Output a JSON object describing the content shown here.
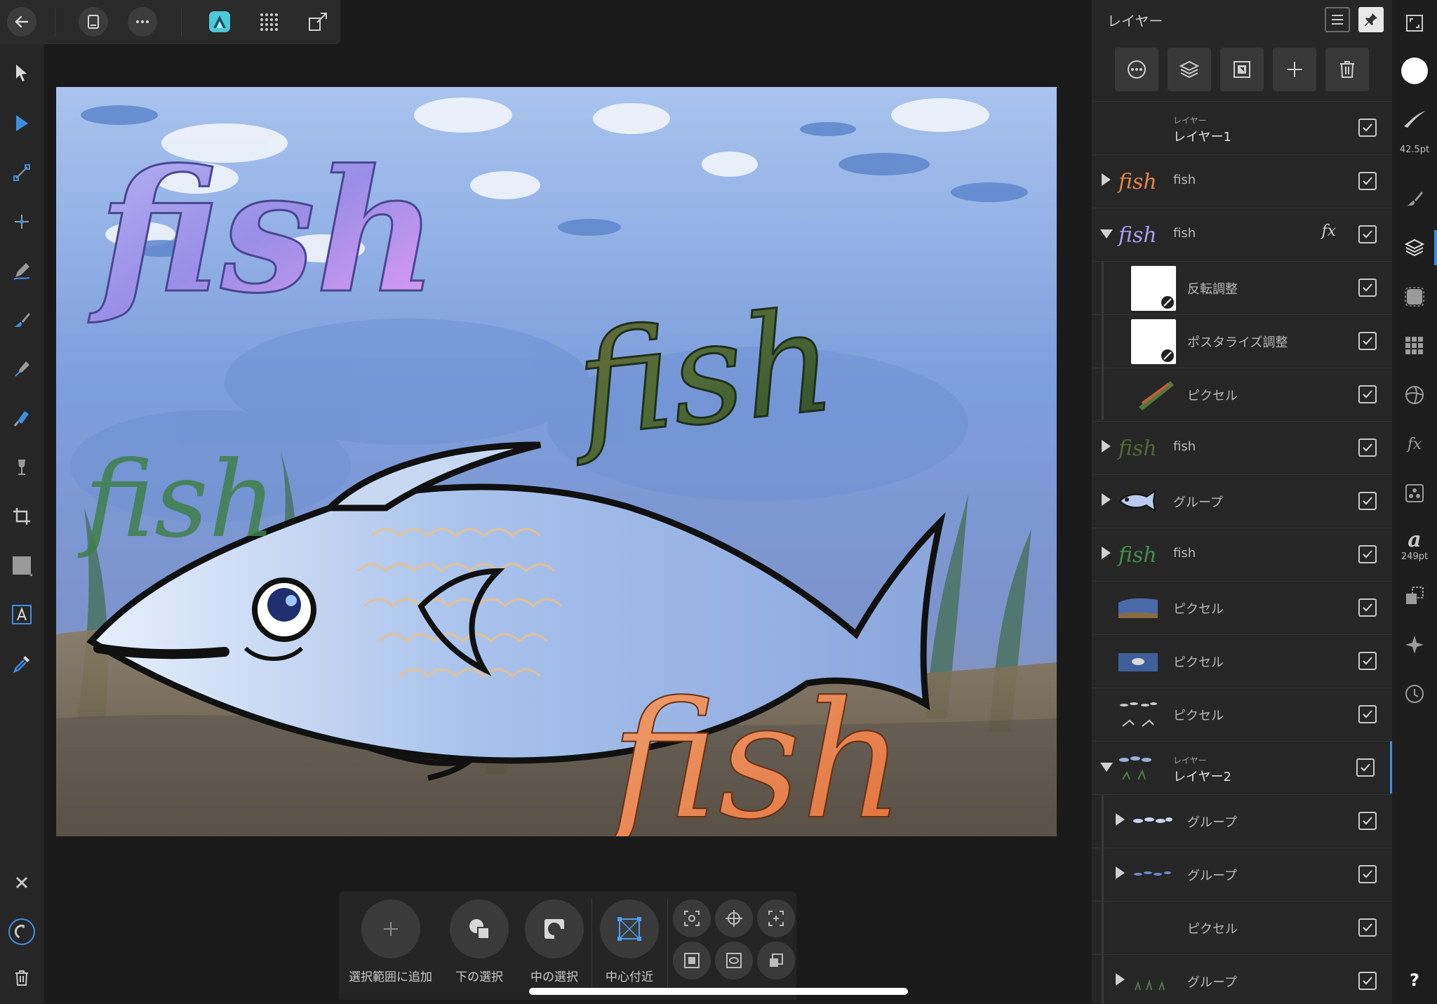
{
  "layers_panel": {
    "title": "レイヤー",
    "rows": [
      {
        "kind": "レイヤー",
        "name": "レイヤー1",
        "checked": true
      },
      {
        "name": "fish",
        "checked": true
      },
      {
        "name": "fish",
        "checked": true,
        "fx": "fx"
      },
      {
        "name": "反転調整",
        "checked": true
      },
      {
        "name": "ポスタライズ調整",
        "checked": true
      },
      {
        "name": "ピクセル",
        "checked": true
      },
      {
        "name": "fish",
        "checked": true
      },
      {
        "name": "グループ",
        "checked": true
      },
      {
        "name": "fish",
        "checked": true
      },
      {
        "name": "ピクセル",
        "checked": true
      },
      {
        "name": "ピクセル",
        "checked": true
      },
      {
        "name": "ピクセル",
        "checked": true
      },
      {
        "kind": "レイヤー",
        "name": "レイヤー2",
        "checked": true
      },
      {
        "name": "グループ",
        "checked": true
      },
      {
        "name": "グループ",
        "checked": true
      },
      {
        "name": "ピクセル",
        "checked": true
      },
      {
        "name": "グループ",
        "checked": true
      }
    ]
  },
  "studio": {
    "brush_size": "42.5pt",
    "font_size": "249pt",
    "help": "?",
    "fx_label": "fx",
    "char_label": "a"
  },
  "context_toolbar": {
    "add_to_selection": "選択範囲に追加",
    "select_below": "下の選択",
    "select_inside": "中の選択",
    "near_center": "中心付近"
  },
  "canvas": {
    "texts": [
      "fish",
      "fish",
      "fish",
      "fish"
    ]
  }
}
